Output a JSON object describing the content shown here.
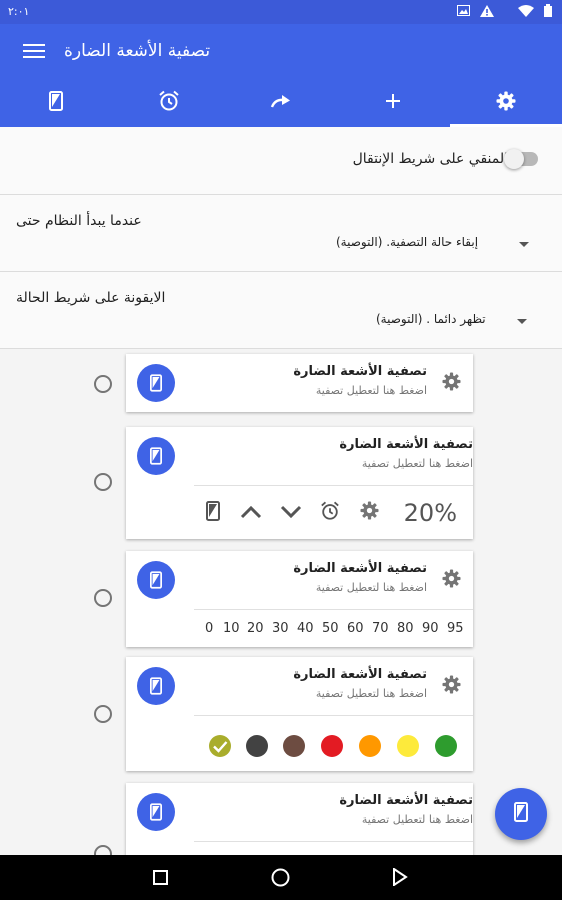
{
  "status_bar": {
    "time": "٢:٠١",
    "icons": [
      "image-icon",
      "alert-icon",
      "wifi-icon",
      "battery-icon"
    ]
  },
  "app_bar": {
    "title": "تصفية الأشعة الضارة",
    "menu_icon": "menu-icon"
  },
  "tabs": [
    {
      "icon": "phone-filter-icon",
      "active": false
    },
    {
      "icon": "alarm-icon",
      "active": false
    },
    {
      "icon": "redo-icon",
      "active": false
    },
    {
      "icon": "plus-icon",
      "active": false
    },
    {
      "icon": "gear-icon",
      "active": true
    }
  ],
  "settings": {
    "navbar_toggle_label": "المنقي على شريط الإنتقال",
    "navbar_toggle_on": false,
    "startup": {
      "heading": "عندما يبدأ النظام حتى",
      "value": "إبقاء حالة التصفية. (التوصية)"
    },
    "status_icon": {
      "heading": "الايقونة على شريط الحالة",
      "value": "تظهر دائما . (التوصية)"
    }
  },
  "widget_style": {
    "title": "تصفية الأشعة الضارة",
    "subtitle": "اضغط هنا لتعطيل تصفية"
  },
  "card2": {
    "percent": "20%"
  },
  "card3": {
    "numbers": [
      "0",
      "10",
      "20",
      "30",
      "40",
      "50",
      "60",
      "70",
      "80",
      "90",
      "95"
    ]
  },
  "card4": {
    "colors": [
      "#a9ad2c",
      "#424242",
      "#6d4c41",
      "#e31b23",
      "#ff9800",
      "#fdea3b",
      "#2e9c2e"
    ],
    "selected_color_index": 0
  },
  "accent_color": "#3f63e6",
  "nav_bar": {
    "icons": [
      "recents-icon",
      "home-icon",
      "back-icon"
    ]
  }
}
